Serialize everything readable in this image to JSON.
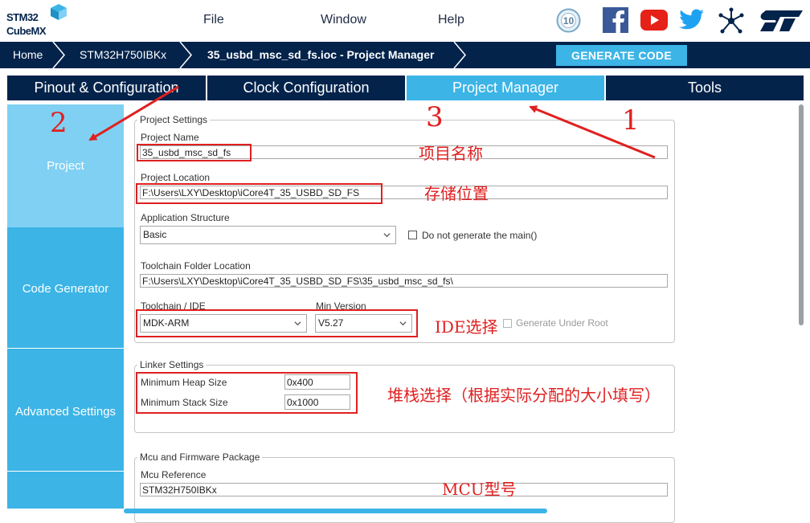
{
  "app": {
    "logo_line1": "STM32",
    "logo_line2": "CubeMX"
  },
  "menu": {
    "file": "File",
    "window": "Window",
    "help": "Help"
  },
  "social_icons": [
    "anniversary-10-icon",
    "facebook-icon",
    "youtube-icon",
    "twitter-icon",
    "network-icon",
    "st-logo-icon"
  ],
  "breadcrumb": {
    "home": "Home",
    "mcu": "STM32H750IBKx",
    "project": "35_usbd_msc_sd_fs.ioc - Project Manager"
  },
  "generate_button": "GENERATE CODE",
  "tabs": [
    "Pinout & Configuration",
    "Clock Configuration",
    "Project Manager",
    "Tools"
  ],
  "active_tab": "Project Manager",
  "sidebar": [
    "Project",
    "Code Generator",
    "Advanced Settings"
  ],
  "project_settings": {
    "legend": "Project Settings",
    "name_label": "Project Name",
    "name_value": "35_usbd_msc_sd_fs",
    "location_label": "Project Location",
    "location_value": "F:\\Users\\LXY\\Desktop\\iCore4T_35_USBD_SD_FS",
    "app_structure_label": "Application Structure",
    "app_structure_value": "Basic",
    "no_main_label": "Do not generate the main()",
    "toolchain_folder_label": "Toolchain Folder Location",
    "toolchain_folder_value": "F:\\Users\\LXY\\Desktop\\iCore4T_35_USBD_SD_FS\\35_usbd_msc_sd_fs\\",
    "toolchain_label": "Toolchain / IDE",
    "toolchain_value": "MDK-ARM",
    "min_version_label": "Min Version",
    "min_version_value": "V5.27",
    "gen_under_root_label": "Generate Under Root"
  },
  "linker_settings": {
    "legend": "Linker Settings",
    "heap_label": "Minimum Heap Size",
    "heap_value": "0x400",
    "stack_label": "Minimum Stack Size",
    "stack_value": "0x1000"
  },
  "mcu_package": {
    "legend": "Mcu and Firmware Package",
    "ref_label": "Mcu Reference",
    "ref_value": "STM32H750IBKx"
  },
  "annotations": {
    "n1": "1",
    "n2": "2",
    "n3": "3",
    "project_name_cn": "项目名称",
    "location_cn": "存储位置",
    "ide_cn": "IDE选择",
    "stack_cn": "堆栈选择（根据实际分配的大小填写）",
    "mcu_cn": "MCU型号"
  },
  "colors": {
    "navy": "#03234b",
    "accent": "#3cb4e6",
    "annotation_red": "#e02020"
  }
}
